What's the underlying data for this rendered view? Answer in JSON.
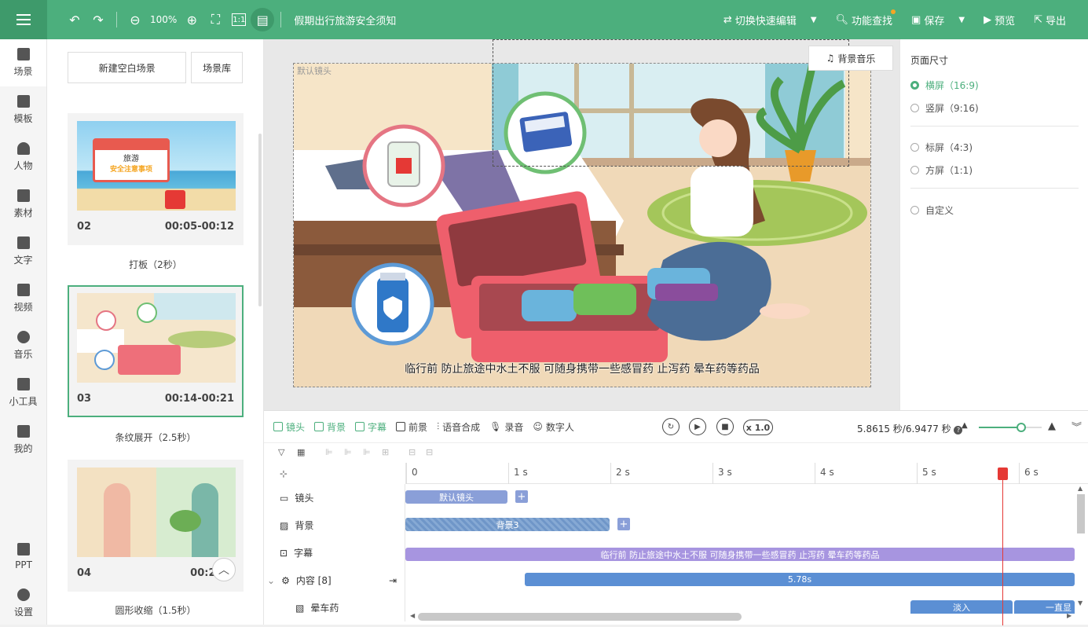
{
  "header": {
    "zoom": "100%",
    "doc_title": "假期出行旅游安全须知",
    "actions": {
      "quick_edit": "切换快速编辑",
      "find": "功能查找",
      "save": "保存",
      "preview": "预览",
      "export": "导出"
    }
  },
  "nav": [
    {
      "label": "场景"
    },
    {
      "label": "模板"
    },
    {
      "label": "人物"
    },
    {
      "label": "素材"
    },
    {
      "label": "文字"
    },
    {
      "label": "视频"
    },
    {
      "label": "音乐"
    },
    {
      "label": "小工具"
    },
    {
      "label": "我的"
    }
  ],
  "nav_bottom": [
    {
      "label": "PPT"
    },
    {
      "label": "设置"
    }
  ],
  "scenes": {
    "new_blank": "新建空白场景",
    "library": "场景库",
    "items": [
      {
        "num": "02",
        "time": "00:05-00:12",
        "label": "打板（2秒）",
        "thumb_text1": "旅游",
        "thumb_text2": "安全注意事项"
      },
      {
        "num": "03",
        "time": "00:14-00:21",
        "label": "条纹展开（2.5秒）"
      },
      {
        "num": "04",
        "time": "00:23-0",
        "label": "圆形收缩（1.5秒）"
      }
    ]
  },
  "canvas": {
    "lens_label": "默认镜头",
    "bgm": "背景音乐",
    "subtitle": "临行前 防止旅途中水土不服 可随身携带一些感冒药 止泻药 晕车药等药品"
  },
  "page_size": {
    "title": "页面尺寸",
    "options": [
      {
        "label": "横屏（16:9)",
        "selected": true
      },
      {
        "label": "竖屏（9:16)",
        "selected": false
      },
      {
        "label": "标屏（4:3)",
        "selected": false
      },
      {
        "label": "方屏（1:1)",
        "selected": false
      },
      {
        "label": "自定义",
        "selected": false
      }
    ]
  },
  "timeline": {
    "tabs": {
      "lens": "镜头",
      "bg": "背景",
      "subtitle": "字幕",
      "fg": "前景",
      "tts": "语音合成",
      "record": "录音",
      "avatar": "数字人"
    },
    "speed": "x 1.0",
    "time_readout": "5.8615 秒/6.9477 秒",
    "ruler": [
      "0",
      "1 s",
      "2 s",
      "3 s",
      "4 s",
      "5 s",
      "6 s"
    ],
    "tracks": {
      "lens": "镜头",
      "bg": "背景",
      "subtitle": "字幕",
      "content": "内容 [8]",
      "motion": "晕车药"
    },
    "clips": {
      "lens": "默认镜头",
      "bg": "背景3",
      "subtitle": "临行前 防止旅途中水土不服 可随身携带一些感冒药 止泻药 晕车药等药品",
      "content": "5.78s",
      "fade": "淡入",
      "always": "一直显"
    }
  },
  "colors": {
    "accent": "#4caf7d",
    "lens_clip": "#8a9fd8",
    "bg_clip": "#6f96c8",
    "subtitle_clip": "#a795e0",
    "content_clip": "#5b8fd4",
    "playhead": "#e53935"
  }
}
